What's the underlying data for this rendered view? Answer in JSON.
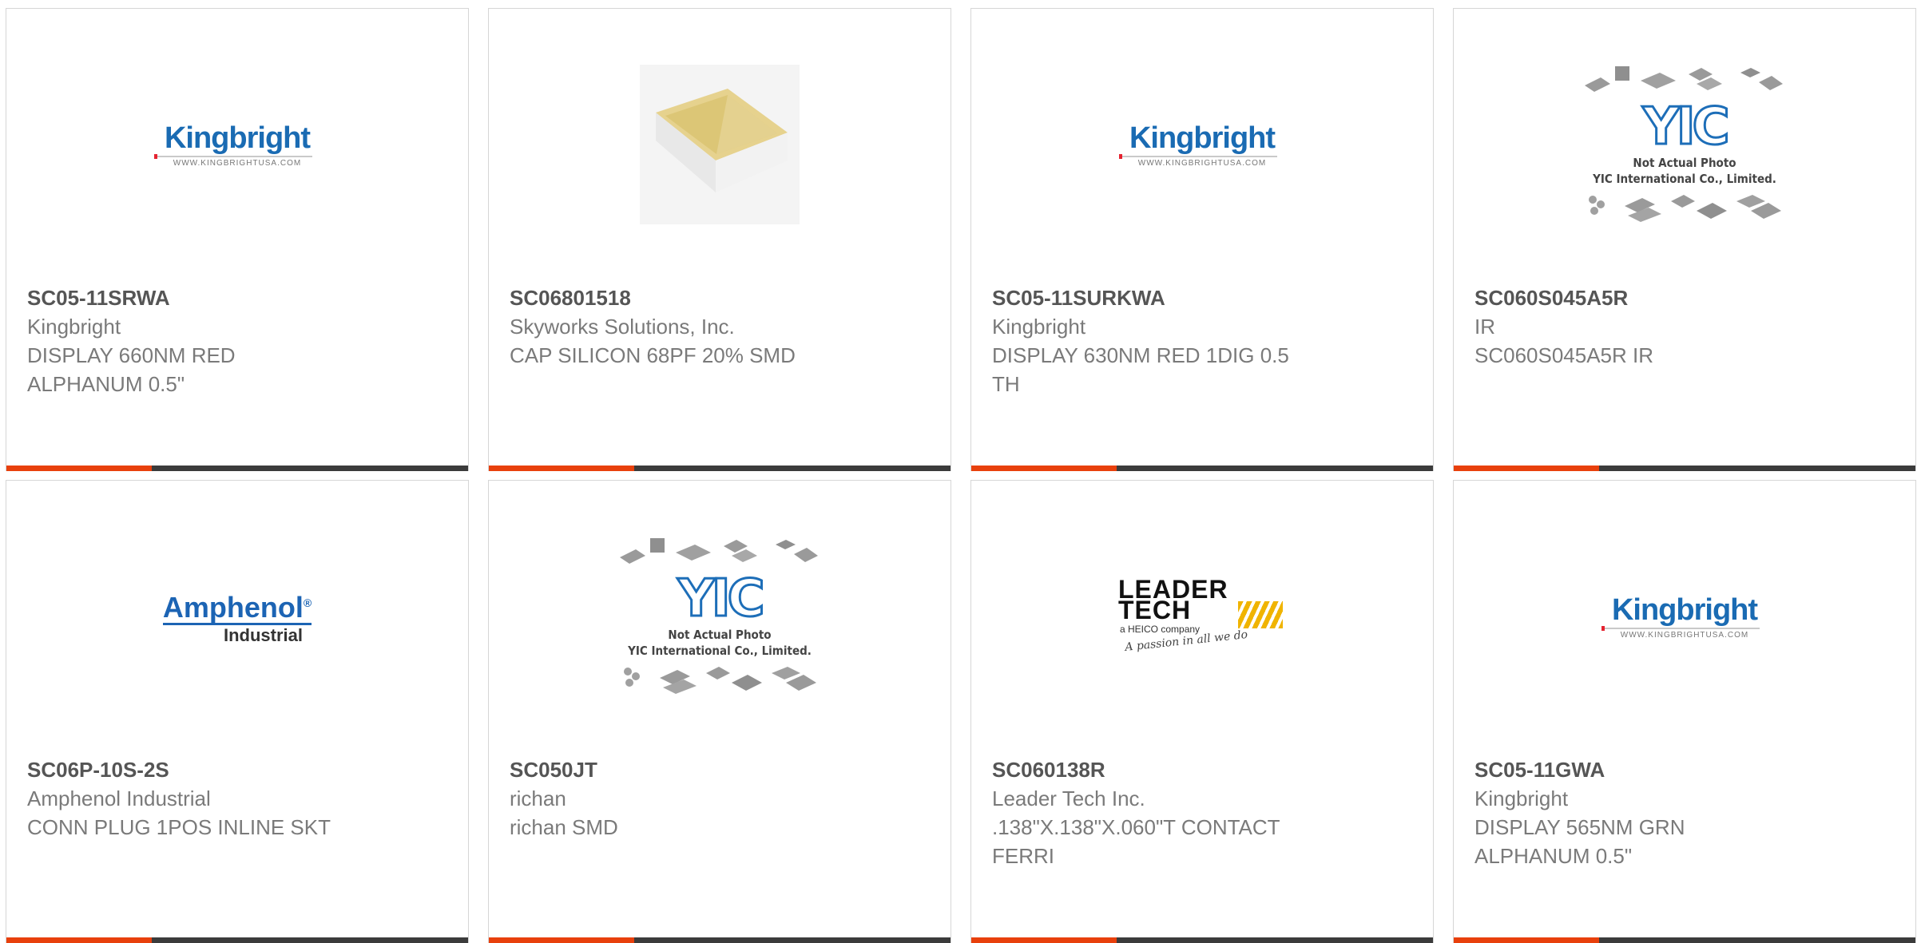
{
  "products": [
    {
      "part": "SC05-11SRWA",
      "maker": "Kingbright",
      "desc": "DISPLAY 660NM RED ALPHANUM 0.5\"",
      "logo": {
        "type": "kingbright",
        "word": "Kingbright",
        "url": "WWW.KINGBRIGHTUSA.COM"
      }
    },
    {
      "part": "SC06801518",
      "maker": "Skyworks Solutions, Inc.",
      "desc": "CAP SILICON 68PF 20% SMD",
      "logo": {
        "type": "capacitor-photo"
      }
    },
    {
      "part": "SC05-11SURKWA",
      "maker": "Kingbright",
      "desc": "DISPLAY 630NM RED 1DIG 0.5 TH",
      "logo": {
        "type": "kingbright",
        "word": "Kingbright",
        "url": "WWW.KINGBRIGHTUSA.COM"
      }
    },
    {
      "part": "SC060S045A5R",
      "maker": "IR",
      "desc": "SC060S045A5R IR",
      "logo": {
        "type": "yic",
        "mark": "YIC",
        "line1": "Not Actual Photo",
        "line2": "YIC International Co., Limited."
      }
    },
    {
      "part": "SC06P-10S-2S",
      "maker": "Amphenol Industrial",
      "desc": "CONN PLUG 1POS INLINE SKT",
      "logo": {
        "type": "amphenol",
        "word": "Amphenol",
        "sub": "Industrial"
      }
    },
    {
      "part": "SC050JT",
      "maker": "richan",
      "desc": "richan SMD",
      "logo": {
        "type": "yic",
        "mark": "YIC",
        "line1": "Not Actual Photo",
        "line2": "YIC International Co., Limited."
      }
    },
    {
      "part": "SC060138R",
      "maker": "Leader Tech Inc.",
      "desc": ".138\"X.138\"X.060\"T CONTACT FERRI",
      "logo": {
        "type": "leadertech",
        "word1": "LEADER",
        "word2": "TECH",
        "heico": "a HEICO company",
        "tag": "A passion in all we do"
      }
    },
    {
      "part": "SC05-11GWA",
      "maker": "Kingbright",
      "desc": "DISPLAY 565NM GRN ALPHANUM 0.5\"",
      "logo": {
        "type": "kingbright",
        "word": "Kingbright",
        "url": "WWW.KINGBRIGHTUSA.COM"
      }
    }
  ],
  "colors": {
    "accent_orange": "#e8400c",
    "accent_dark": "#3b3b3b",
    "kingbright_blue": "#1a6bb3"
  }
}
